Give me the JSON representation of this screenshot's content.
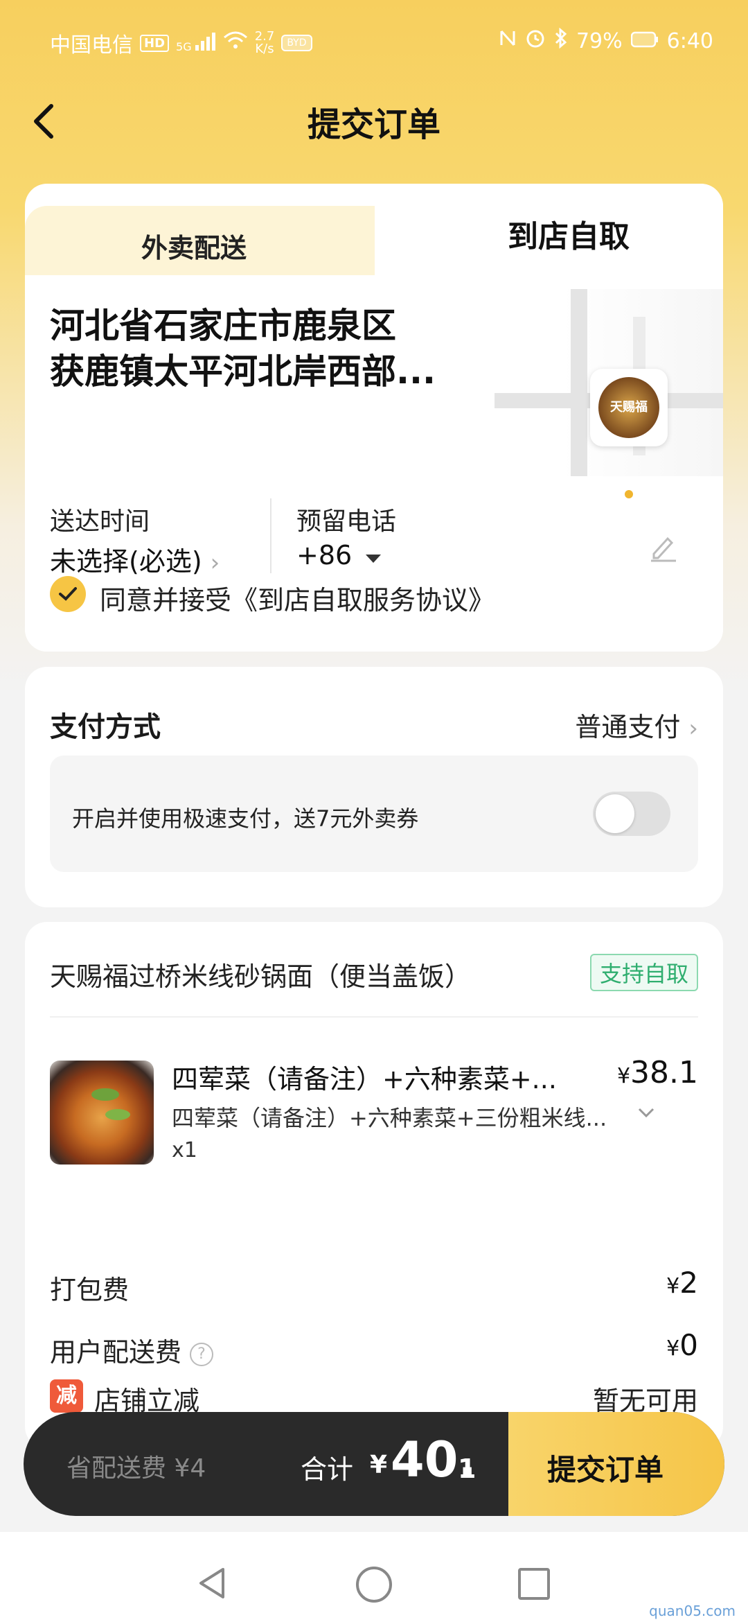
{
  "status_bar": {
    "carrier": "中国电信",
    "hd": "HD",
    "network": "5G",
    "speed_value": "2.7",
    "speed_unit": "K/s",
    "byd": "BYD",
    "battery": "79%",
    "time": "6:40"
  },
  "header": {
    "back_icon": "chevron-left-icon",
    "title": "提交订单"
  },
  "tabs": {
    "delivery": "外卖配送",
    "pickup": "到店自取",
    "active": "pickup"
  },
  "address": {
    "line1": "河北省石家庄市鹿泉区",
    "line2": "获鹿镇太平河北岸西部..."
  },
  "store_pin": {
    "logo_text": "天赐福"
  },
  "delivery_time": {
    "label": "送达时间",
    "value": "未选择(必选)"
  },
  "phone": {
    "label": "预留电话",
    "prefix": "+86"
  },
  "agreement": {
    "checked": true,
    "text": "同意并接受《到店自取服务协议》"
  },
  "payment": {
    "label": "支付方式",
    "value": "普通支付",
    "fast_pay_text": "开启并使用极速支付，送7元外卖券",
    "fast_pay_enabled": false
  },
  "store": {
    "name": "天赐福过桥米线砂锅面（便当盖饭）",
    "tag": "支持自取"
  },
  "item": {
    "title": "四荤菜（请备注）+六种素菜+...",
    "price_symbol": "¥",
    "price": "38.1",
    "desc": "四荤菜（请备注）+六种素菜+三份粗米线...",
    "qty": "x1"
  },
  "fees": {
    "packing_label": "打包费",
    "packing_symbol": "¥",
    "packing_value": "2",
    "delivery_label": "用户配送费",
    "delivery_symbol": "¥",
    "delivery_value": "0",
    "discount_badge": "减",
    "discount_label": "店铺立减",
    "discount_value": "暂无可用"
  },
  "bottom": {
    "saved": "省配送费 ¥4",
    "total_label": "合计",
    "total_symbol": "¥",
    "total_int": "40.",
    "total_dec": "1",
    "submit": "提交订单"
  },
  "watermark": "quan05.com",
  "colors": {
    "accent": "#f6c544",
    "header_bg": "#f7cf5e",
    "bar_dark": "#2a2a2a",
    "tag_green": "#2fae6f",
    "discount_red": "#ef5a3a"
  }
}
